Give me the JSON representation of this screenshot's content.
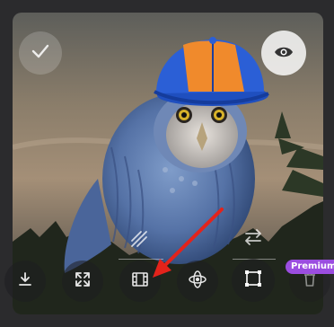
{
  "toolbar": {
    "premium_label": "Premium"
  },
  "icons": {
    "apply": "checkmark-icon",
    "preview": "eye-icon",
    "swap": "swap-arrows-icon",
    "diagonal": "diagonal-lines-icon",
    "download": "download-icon",
    "expand": "expand-icon",
    "film": "film-strip-icon",
    "orbit": "orbit-icon",
    "crop": "crop-frame-icon",
    "trash": "trash-icon"
  },
  "colors": {
    "badge": "#9b4de0",
    "annotation_arrow": "#e3231b",
    "cap_orange": "#f08a2c",
    "cap_blue": "#2b5fd6"
  }
}
